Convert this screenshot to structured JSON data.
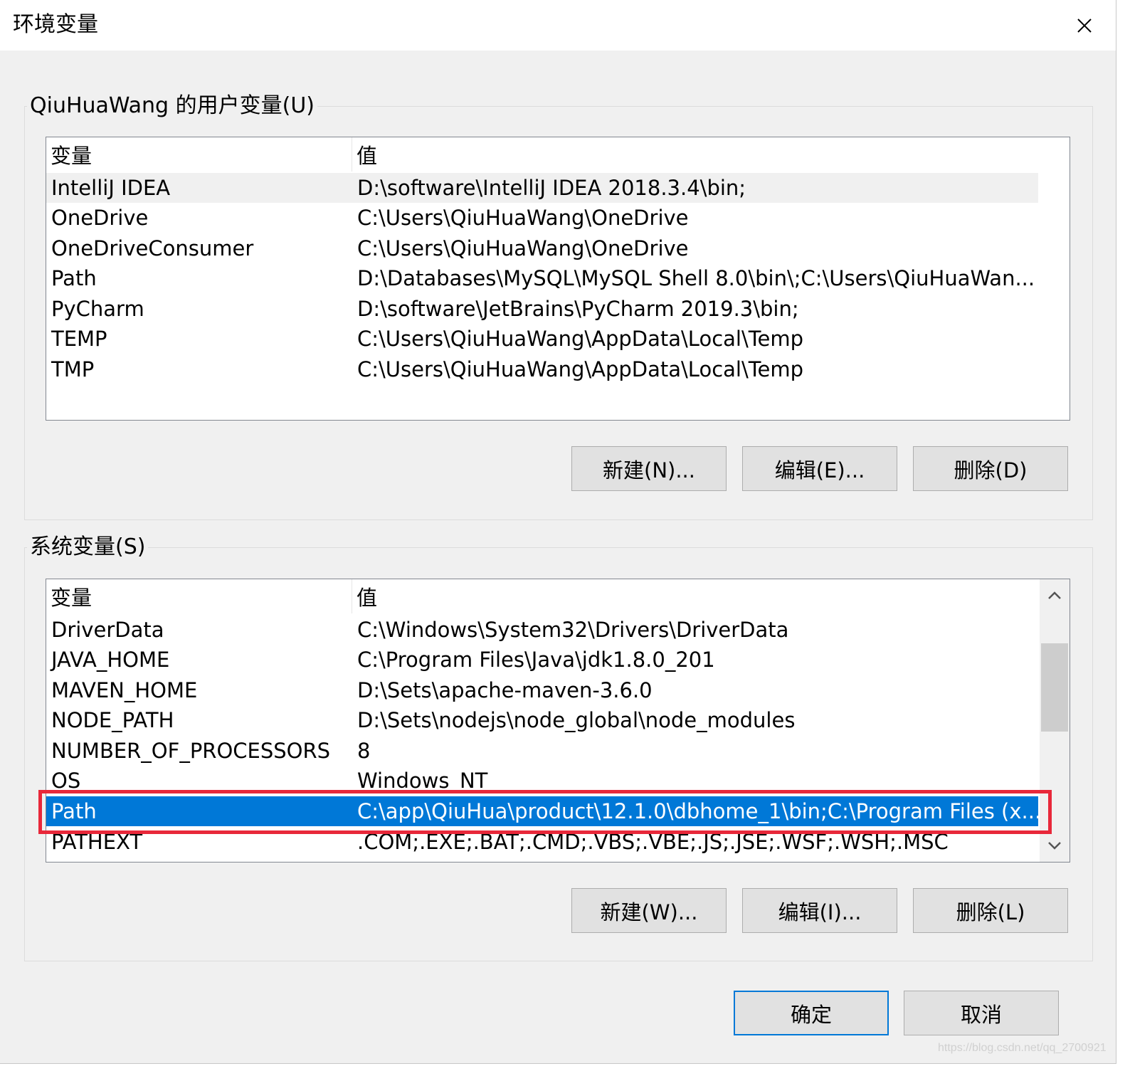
{
  "window": {
    "title": "环境变量"
  },
  "user_vars": {
    "group_label": "QiuHuaWang 的用户变量(U)",
    "columns": [
      "变量",
      "值"
    ],
    "rows": [
      {
        "name": "IntelliJ IDEA",
        "value": "D:\\software\\IntelliJ IDEA 2018.3.4\\bin;"
      },
      {
        "name": "OneDrive",
        "value": "C:\\Users\\QiuHuaWang\\OneDrive"
      },
      {
        "name": "OneDriveConsumer",
        "value": "C:\\Users\\QiuHuaWang\\OneDrive"
      },
      {
        "name": "Path",
        "value": "D:\\Databases\\MySQL\\MySQL Shell 8.0\\bin\\;C:\\Users\\QiuHuaWan..."
      },
      {
        "name": "PyCharm",
        "value": "D:\\software\\JetBrains\\PyCharm 2019.3\\bin;"
      },
      {
        "name": "TEMP",
        "value": "C:\\Users\\QiuHuaWang\\AppData\\Local\\Temp"
      },
      {
        "name": "TMP",
        "value": "C:\\Users\\QiuHuaWang\\AppData\\Local\\Temp"
      }
    ],
    "buttons": {
      "new": "新建(N)...",
      "edit": "编辑(E)...",
      "delete": "删除(D)"
    }
  },
  "system_vars": {
    "group_label": "系统变量(S)",
    "columns": [
      "变量",
      "值"
    ],
    "rows": [
      {
        "name": "DriverData",
        "value": "C:\\Windows\\System32\\Drivers\\DriverData"
      },
      {
        "name": "JAVA_HOME",
        "value": "C:\\Program Files\\Java\\jdk1.8.0_201"
      },
      {
        "name": "MAVEN_HOME",
        "value": "D:\\Sets\\apache-maven-3.6.0"
      },
      {
        "name": "NODE_PATH",
        "value": "D:\\Sets\\nodejs\\node_global\\node_modules"
      },
      {
        "name": "NUMBER_OF_PROCESSORS",
        "value": "8"
      },
      {
        "name": "OS",
        "value": "Windows_NT"
      },
      {
        "name": "Path",
        "value": "C:\\app\\QiuHua\\product\\12.1.0\\dbhome_1\\bin;C:\\Program Files (x..."
      },
      {
        "name": "PATHEXT",
        "value": ".COM;.EXE;.BAT;.CMD;.VBS;.VBE;.JS;.JSE;.WSF;.WSH;.MSC"
      }
    ],
    "selected_row": "Path",
    "buttons": {
      "new": "新建(W)...",
      "edit": "编辑(I)...",
      "delete": "删除(L)"
    }
  },
  "footer": {
    "ok": "确定",
    "cancel": "取消"
  },
  "watermark": "https://blog.csdn.net/qq_2700921",
  "colors": {
    "selection": "#0078d7",
    "highlight_border": "#e8283a",
    "dialog_bg": "#f0f0f0"
  },
  "icons": {
    "close": "close-icon",
    "scroll_up": "chevron-up-icon",
    "scroll_down": "chevron-down-icon"
  }
}
